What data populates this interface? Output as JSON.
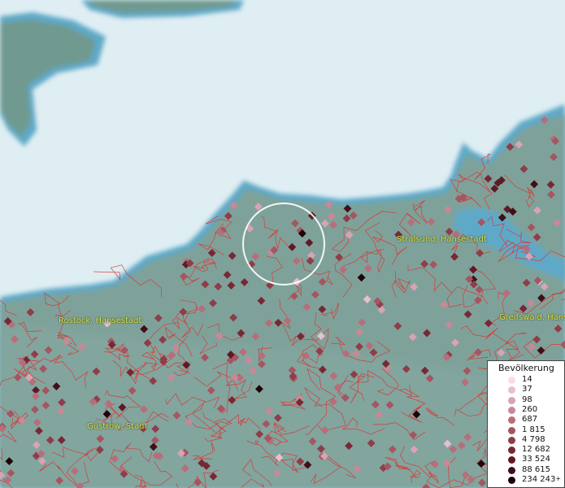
{
  "map": {
    "cities": [
      {
        "name": "Rostock, Hansestadt"
      },
      {
        "name": "Stralsund, Hansestadt"
      },
      {
        "name": "Greifswald, Hans"
      },
      {
        "name": "Güstrow, Stadt"
      }
    ],
    "colors": {
      "sea": "#dfeef3",
      "coast": "#5fa9c8",
      "land": "#7ea29a",
      "borders": "#e0302e",
      "highlight": "#ffffff"
    }
  },
  "legend": {
    "title": "Bevölkerung",
    "items": [
      {
        "label": "14",
        "color": "#f6dde8"
      },
      {
        "label": "37",
        "color": "#e8bfcc"
      },
      {
        "label": "98",
        "color": "#d8a3b2"
      },
      {
        "label": "260",
        "color": "#c98896"
      },
      {
        "label": "687",
        "color": "#b86d7b"
      },
      {
        "label": "1 815",
        "color": "#a65561"
      },
      {
        "label": "4 798",
        "color": "#8f3d49"
      },
      {
        "label": "12 682",
        "color": "#782835"
      },
      {
        "label": "33 524",
        "color": "#5e1a25"
      },
      {
        "label": "88 615",
        "color": "#420e17"
      },
      {
        "label": "234 243",
        "color": "#200306",
        "plus": "+"
      }
    ]
  }
}
